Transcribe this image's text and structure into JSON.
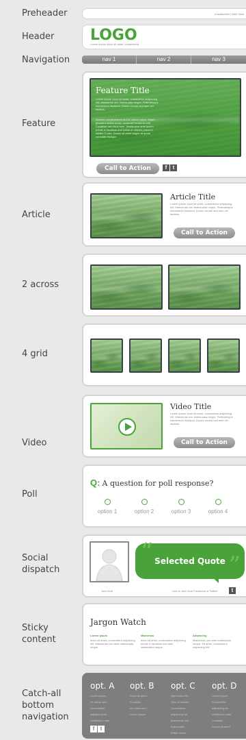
{
  "labels": {
    "preheader": "Preheader",
    "header": "Header",
    "navigation": "Navigation",
    "feature": "Feature",
    "article": "Article",
    "two_across": "2 across",
    "four_grid": "4 grid",
    "video": "Video",
    "poll": "Poll",
    "social": "Social\ndispatch",
    "sticky": "Sticky\ncontent",
    "catchall": "Catch-all\nbottom\nnavigation"
  },
  "preheader": {
    "links": "Unsubscribe | Web View"
  },
  "header": {
    "logo": "LOGO",
    "tagline": "Lorem ipsum dolor sit amet, consectetur"
  },
  "nav": [
    "nav 1",
    "nav 2",
    "nav 3"
  ],
  "feature": {
    "title": "Feature Title",
    "body1": "Lorem ipsum dolor sit amet, consectetur adipiscing elit. Maecenas non malesuada neque. Pellentesque elementum tincidunt. Donec ornare sed sem vel facilisis.",
    "body2": "Aenean condimentum dui ac varius varius. Etiam pharetra facilisi tortor, hendrerit hendrerit velit. Curabitur nec risus sem. Vestibulum ante ipsum primis in faucibus orci luctus et ultrices posuere cubilia Curae; Donec sit amet augue at quam convallis tristique.",
    "cta": "Call to Action",
    "social": [
      "f",
      "t"
    ]
  },
  "article": {
    "title": "Article Title",
    "body": "Lorem ipsum dolor sit amet, consectetur adipiscing elit. Maecenas non malesuada neque. Pellentesque elementum tincidunt. Donec ornare sed sem vel facilisis.",
    "cta": "Call to Action"
  },
  "video": {
    "title": "Video Title",
    "body": "Lorem ipsum dolor sit amet, consectetur adipiscing elit. Maecenas non malesuada neque. Pellentesque elementum tincidunt. Donec ornare sed sem vel facilisis.",
    "cta": "Call to Action"
  },
  "poll": {
    "q": "Q:",
    "question": "A question for poll response?",
    "options": [
      "option 1",
      "option 2",
      "option 3",
      "option 4"
    ]
  },
  "social_dispatch": {
    "name": "John Doe",
    "quote": "Selected Quote",
    "link": "Link to John Doe Facebook or Twitter"
  },
  "sticky": {
    "title": "Jargon Watch",
    "cols": [
      {
        "h": "Lorem ipsum",
        "t": "dolor sit amet, consectetur adipiscing elit. Maecenas non ante malesuada neque."
      },
      {
        "h": "Maecenas",
        "t": "dolor sit amet, consectetur adipiscing primis in faucibus orci ante malesuada neque."
      },
      {
        "h": "Adipiscing",
        "t": "Maecenas non ante malesuada neque. Sit amet, consectetur adipiscing elit."
      }
    ]
  },
  "catchall": {
    "cols": [
      {
        "h": "opt. A",
        "items": [
          "Lorem ipsum",
          "Ut varius sem",
          "Consectetur",
          "adipiscing elit",
          "",
          "Vestibulum ante",
          "Curabitur",
          "Morbi"
        ]
      },
      {
        "h": "opt. B",
        "items": [
          "Dolor sit amet",
          "Curabitur",
          "nec risus sem",
          "Lorem ipsum"
        ]
      },
      {
        "h": "opt. C",
        "items": [
          "Nam dolor elit",
          "Sem at massa",
          "Consectetur",
          "adipiscing elit",
          "Maecenas non",
          "malesuada",
          "",
          "Etiam varius"
        ]
      },
      {
        "h": "opt. D",
        "items": [
          "Lorem ipsum",
          "Consectetur",
          "adipiscing elit",
          "",
          "Vestibulum ante",
          "Curabitur",
          "Donec sit amet"
        ]
      }
    ],
    "social": [
      "f",
      "t"
    ]
  },
  "colors": {
    "accent": "#4aa23a",
    "dark": "#374045",
    "footer": "#7e7e7e"
  }
}
